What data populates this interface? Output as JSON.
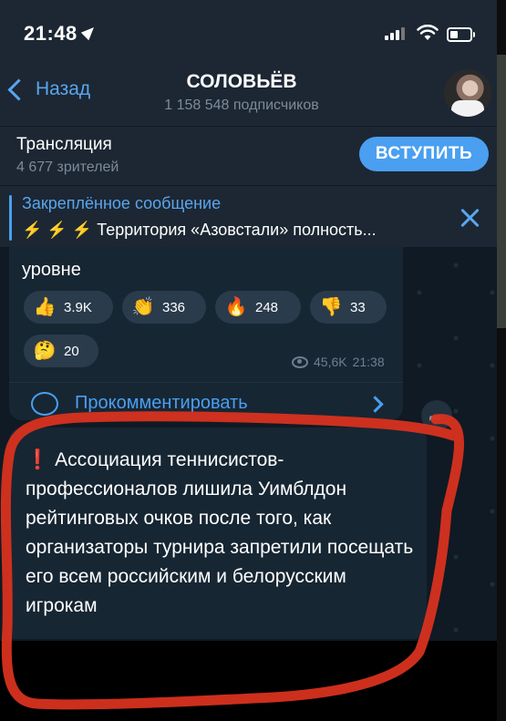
{
  "status_bar": {
    "time": "21:48"
  },
  "header": {
    "back_label": "Назад",
    "channel_name": "СОЛОВЬЁВ",
    "subscribers": "1 158 548 подписчиков"
  },
  "broadcast": {
    "title": "Трансляция",
    "viewers": "4 677 зрителей",
    "join_label": "ВСТУПИТЬ"
  },
  "pinned": {
    "title": "Закреплённое сообщение",
    "text": "⚡ ⚡ ⚡ Территория «Азовстали» полность..."
  },
  "post1": {
    "text_tail": "уровне",
    "reactions": [
      {
        "emoji": "👍",
        "count": "3.9K"
      },
      {
        "emoji": "👏",
        "count": "336"
      },
      {
        "emoji": "🔥",
        "count": "248"
      },
      {
        "emoji": "👎",
        "count": "33"
      },
      {
        "emoji": "🤔",
        "count": "20"
      }
    ],
    "views": "45,6K",
    "time": "21:38",
    "comment_label": "Прокомментировать"
  },
  "post2": {
    "icon": "❗",
    "text": "Ассоциация теннисистов-профессионалов лишила Уимблдон рейтинговых очков после того, как организаторы турнира запретили посещать его всем российским и белорусским игрокам"
  },
  "colors": {
    "accent": "#4a9ff0",
    "annotation": "#d8321f",
    "panel": "#1c2733",
    "chat_bg": "#0f1a24"
  }
}
